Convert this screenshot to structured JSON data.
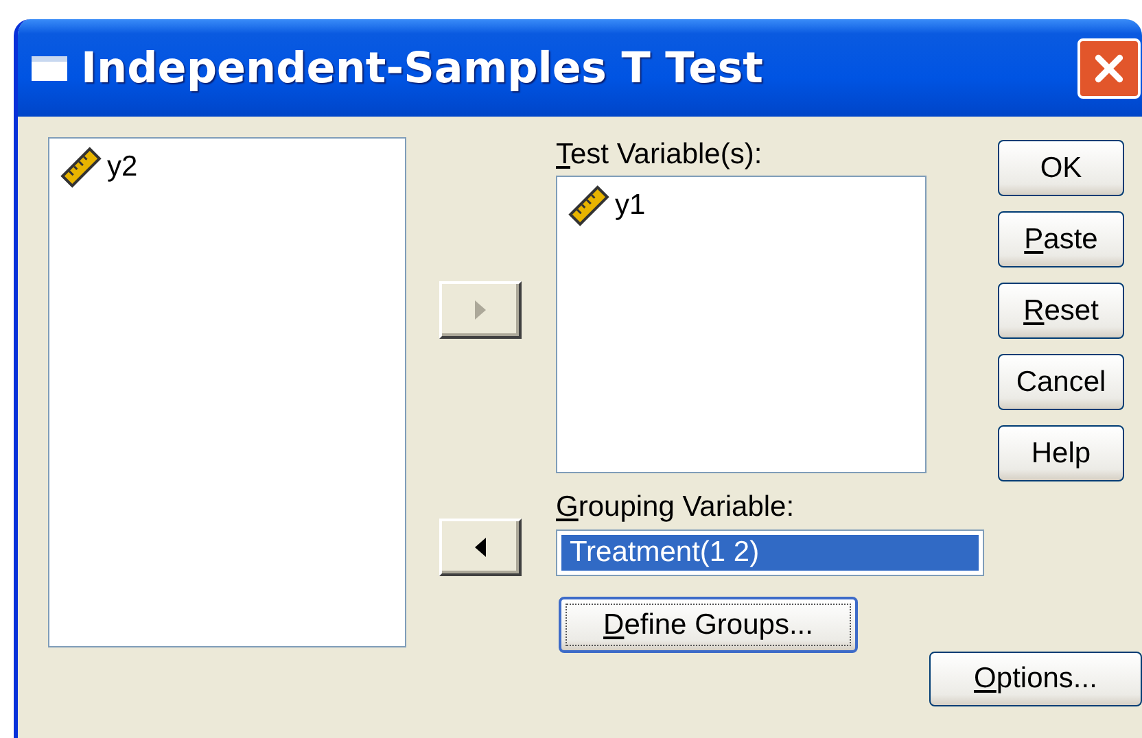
{
  "window": {
    "title": "Independent-Samples T Test"
  },
  "source_list": {
    "items": [
      {
        "name": "y2"
      }
    ]
  },
  "move_buttons": [
    {
      "kind": "right",
      "disabled": true
    },
    {
      "kind": "left",
      "disabled": false
    }
  ],
  "test_variables": {
    "label": {
      "mnemonic": "T",
      "rest": "est Variable(s):"
    },
    "items": [
      {
        "name": "y1"
      }
    ]
  },
  "grouping_variable": {
    "label": {
      "mnemonic": "G",
      "rest": "rouping Variable:"
    },
    "value": "Treatment(1 2)",
    "selected": true
  },
  "define_groups_button": {
    "label": {
      "mnemonic": "D",
      "rest": "efine Groups..."
    },
    "focused": true
  },
  "side_buttons": [
    {
      "label": {
        "rest": "OK"
      }
    },
    {
      "label": {
        "mnemonic": "P",
        "rest": "aste"
      }
    },
    {
      "label": {
        "mnemonic": "R",
        "rest": "eset"
      }
    },
    {
      "label": {
        "rest": "Cancel"
      }
    },
    {
      "label": {
        "rest": "Help"
      }
    }
  ],
  "options_button": {
    "label": {
      "mnemonic": "O",
      "rest": "ptions..."
    }
  }
}
